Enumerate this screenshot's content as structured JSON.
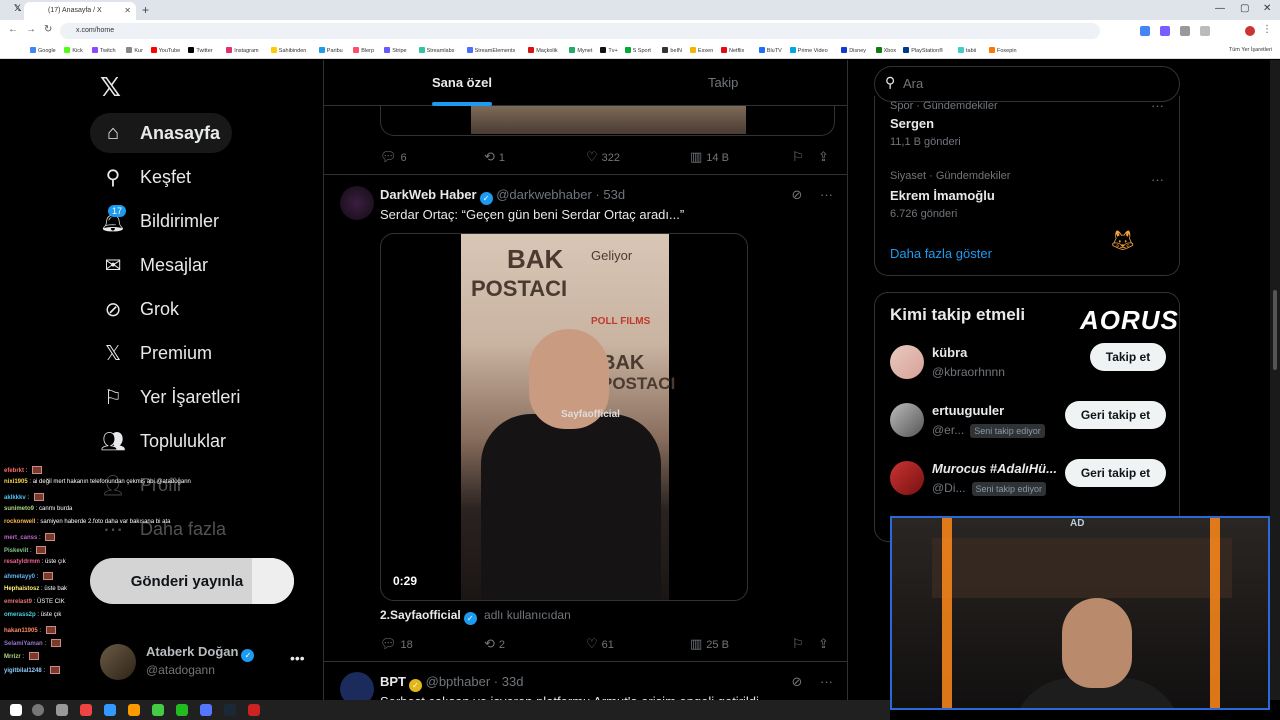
{
  "browser": {
    "tab_title": "(17) Anasayfa / X",
    "url": "x.com/home",
    "bookmarks": [
      "Google",
      "Kick",
      "Twitch",
      "Kur",
      "YouTube",
      "Twitter",
      "Instagram",
      "Sahibinden",
      "Paribu",
      "Blerp",
      "Stripe",
      "Streamlabs",
      "StreamElements",
      "Maçkolik",
      "Mynet",
      "Tv+",
      "S Sport",
      "beIN",
      "Exxen",
      "Netflix",
      "BluTV",
      "Prime Video",
      "Disney",
      "Xbox",
      "PlayStation®",
      "tabii",
      "Foxepin"
    ],
    "bookmarks_right": "Tüm Yer İşaretleri"
  },
  "nav": {
    "home": "Anasayfa",
    "explore": "Keşfet",
    "notifications": "Bildirimler",
    "notif_badge": "17",
    "messages": "Mesajlar",
    "grok": "Grok",
    "premium": "Premium",
    "bookmarks": "Yer İşaretleri",
    "communities": "Topluluklar",
    "profile": "Profil",
    "more": "Daha fazla",
    "post_button": "Gönderi yayınla"
  },
  "account": {
    "name": "Ataberk Doğan",
    "handle": "@atadogann"
  },
  "chat": [
    {
      "user": "efebrkt",
      "msg": ""
    },
    {
      "user": "nixi1905",
      "msg": "ai değil mert hakanın telefonundan çekmiş abi @atadogann"
    },
    {
      "user": "aklkkkv",
      "msg": ""
    },
    {
      "user": "sunimeto9",
      "msg": "canmı burda"
    },
    {
      "user": "rockonwell",
      "msg": "samiyen haberde 2.foto daha var bakısana bi ata"
    },
    {
      "user": "mert_canss",
      "msg": ""
    },
    {
      "user": "Piskeviit",
      "msg": ""
    },
    {
      "user": "resatyldrmm",
      "msg": "üste çık"
    },
    {
      "user": "ahmetayy0",
      "msg": ""
    },
    {
      "user": "Hephaistosz",
      "msg": "üste bak"
    },
    {
      "user": "emrelast9",
      "msg": "ÜSTE CIK"
    },
    {
      "user": "omerass2p",
      "msg": "üste çık"
    },
    {
      "user": "hakan11905",
      "msg": ""
    },
    {
      "user": "SelamiYaman",
      "msg": ""
    },
    {
      "user": "Mrrizr",
      "msg": ""
    },
    {
      "user": "yigitbilal1248",
      "msg": ""
    }
  ],
  "feed": {
    "tab_for_you": "Sana özel",
    "tab_following": "Takip",
    "prev_post": {
      "replies": "6",
      "reposts": "1",
      "likes": "322",
      "views": "14 B"
    },
    "post1": {
      "name": "DarkWeb Haber",
      "handle": "@darkwebhaber",
      "time": "53d",
      "text": "Serdar Ortaç: “Geçen gün beni Serdar Ortaç aradı...”",
      "video_duration": "0:29",
      "credit_name": "2.Sayfaofficial",
      "credit_suffix": "adlı kullanıcıdan",
      "replies": "18",
      "reposts": "2",
      "likes": "61",
      "views": "25 B",
      "watermark": "Sayfaofficial",
      "poster_lines": [
        "BAK",
        "POSTACI",
        "Geliyor",
        "POLL FILMS",
        "BAK",
        "POSTACI"
      ]
    },
    "post2": {
      "name": "BPT",
      "handle": "@bpthaber",
      "time": "33d",
      "text": "Serbest çalışan ve işveren platformu Armut'a erişim engeli getirildi"
    }
  },
  "search": {
    "placeholder": "Ara"
  },
  "trends": [
    {
      "category": "Spor · Gündemdekiler",
      "name": "Sergen",
      "count": "11,1 B gönderi"
    },
    {
      "category": "Siyaset · Gündemdekiler",
      "name": "Ekrem İmamoğlu",
      "count": "6.726 gönderi"
    }
  ],
  "trends_more": "Daha fazla göster",
  "who_to_follow": {
    "title": "Kimi takip etmeli",
    "users": [
      {
        "name": "kübra",
        "handle": "@kbraorhnnn",
        "tag": "",
        "button": "Takip et"
      },
      {
        "name": "ertuuguuler",
        "handle": "@er...",
        "tag": "Seni takip ediyor",
        "button": "Geri takip et"
      },
      {
        "name": "Murocus #AdalıHü...",
        "handle": "@Di...",
        "tag": "Seni takip ediyor",
        "button": "Geri takip et"
      }
    ]
  },
  "overlay": {
    "brand": "AORUS",
    "cam_logo": "AD"
  },
  "colors": {
    "accent": "#1d9bf0",
    "background": "#000000",
    "border": "#2f3336",
    "muted": "#71767b"
  }
}
